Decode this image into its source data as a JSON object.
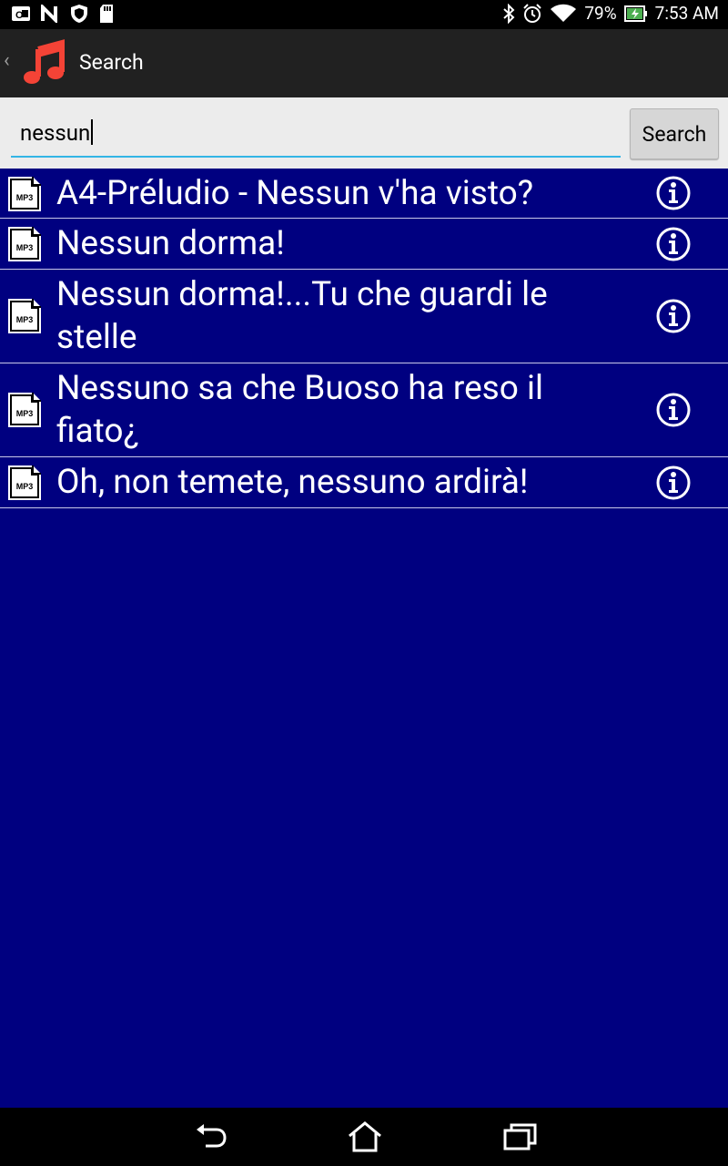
{
  "status_bar": {
    "left_icons": [
      "outlook-icon",
      "n-app-icon",
      "shield-icon",
      "sd-card-icon"
    ],
    "right_icons": [
      "bluetooth-icon",
      "alarm-icon",
      "wifi-icon"
    ],
    "battery_percent": "79%",
    "time": "7:53 AM"
  },
  "action_bar": {
    "title": "Search",
    "app_icon": "music-note-icon",
    "brand_color": "#f44336"
  },
  "search": {
    "query": "nessun",
    "button_label": "Search",
    "underline_color": "#33b5e5"
  },
  "results": [
    {
      "label": "A4-Préludio - Nessun v'ha visto?",
      "file_icon": "mp3-file-icon",
      "file_icon_label": "MP3"
    },
    {
      "label": "Nessun dorma!",
      "file_icon": "mp3-file-icon",
      "file_icon_label": "MP3"
    },
    {
      "label": "Nessun dorma!...Tu che guardi le stelle",
      "file_icon": "mp3-file-icon",
      "file_icon_label": "MP3"
    },
    {
      "label": "Nessuno sa che Buoso ha reso il fiato¿",
      "file_icon": "mp3-file-icon",
      "file_icon_label": "MP3"
    },
    {
      "label": "Oh, non temete, nessuno ardirà!",
      "file_icon": "mp3-file-icon",
      "file_icon_label": "MP3"
    }
  ],
  "nav_bar": {
    "buttons": [
      "back-icon",
      "home-icon",
      "recents-icon"
    ]
  },
  "colors": {
    "list_background": "#000080",
    "row_divider": "#c8c8e8",
    "action_bar": "#212121"
  }
}
